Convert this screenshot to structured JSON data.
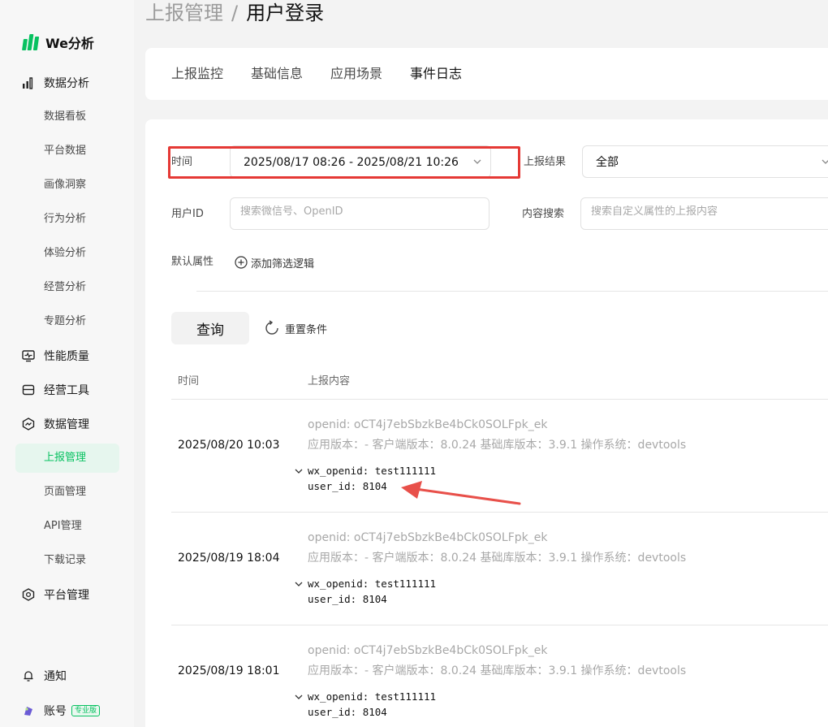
{
  "brand": {
    "name": "We分析",
    "color": "#07c160"
  },
  "sidebar": {
    "groups": [
      {
        "label": "数据分析",
        "icon": "bar-chart-icon"
      },
      {
        "label": "性能质量",
        "icon": "monitor-pulse-icon"
      },
      {
        "label": "经营工具",
        "icon": "storefront-icon"
      },
      {
        "label": "数据管理",
        "icon": "hexagon-chart-icon"
      },
      {
        "label": "平台管理",
        "icon": "hexagon-gear-icon"
      }
    ],
    "analysis_items": [
      "数据看板",
      "平台数据",
      "画像洞察",
      "行为分析",
      "体验分析",
      "经营分析",
      "专题分析"
    ],
    "data_items": [
      "上报管理",
      "页面管理",
      "API管理",
      "下载记录"
    ],
    "active_item": "上报管理",
    "notify_label": "通知",
    "account_label": "账号",
    "pro_badge": "专业版"
  },
  "breadcrumb": {
    "parent": "上报管理",
    "separator": "/",
    "current": "用户登录"
  },
  "tabs": [
    {
      "label": "上报监控",
      "active": false
    },
    {
      "label": "基础信息",
      "active": false
    },
    {
      "label": "应用场景",
      "active": false
    },
    {
      "label": "事件日志",
      "active": true
    }
  ],
  "filters": {
    "time_label": "时间",
    "time_value": "2025/08/17 08:26 - 2025/08/21 10:26",
    "result_label": "上报结果",
    "result_value": "全部",
    "userid_label": "用户ID",
    "userid_placeholder": "搜索微信号、OpenID",
    "content_label": "内容搜索",
    "content_placeholder": "搜索自定义属性的上报内容",
    "default_attr_label": "默认属性",
    "add_filter_label": "添加筛选逻辑",
    "highlight_color": "#e53935"
  },
  "actions": {
    "query": "查询",
    "reset": "重置条件"
  },
  "table": {
    "columns": [
      "时间",
      "上报内容"
    ],
    "rows": [
      {
        "time": "2025/08/20 10:03",
        "openid": "openid: oCT4j7ebSbzkBe4bCk0SOLFpk_ek",
        "meta": "应用版本：- 客户端版本：8.0.24 基础库版本：3.9.1 操作系统：devtools",
        "wx_openid": "wx_openid: test111111",
        "user_id": "user_id: 8104"
      },
      {
        "time": "2025/08/19 18:04",
        "openid": "openid: oCT4j7ebSbzkBe4bCk0SOLFpk_ek",
        "meta": "应用版本：- 客户端版本：8.0.24 基础库版本：3.9.1 操作系统：devtools",
        "wx_openid": "wx_openid: test111111",
        "user_id": "user_id: 8104"
      },
      {
        "time": "2025/08/19 18:01",
        "openid": "openid: oCT4j7ebSbzkBe4bCk0SOLFpk_ek",
        "meta": "应用版本：- 客户端版本：8.0.24 基础库版本：3.9.1 操作系统：devtools",
        "wx_openid": "wx_openid: test111111",
        "user_id": "user_id: 8104"
      }
    ]
  }
}
